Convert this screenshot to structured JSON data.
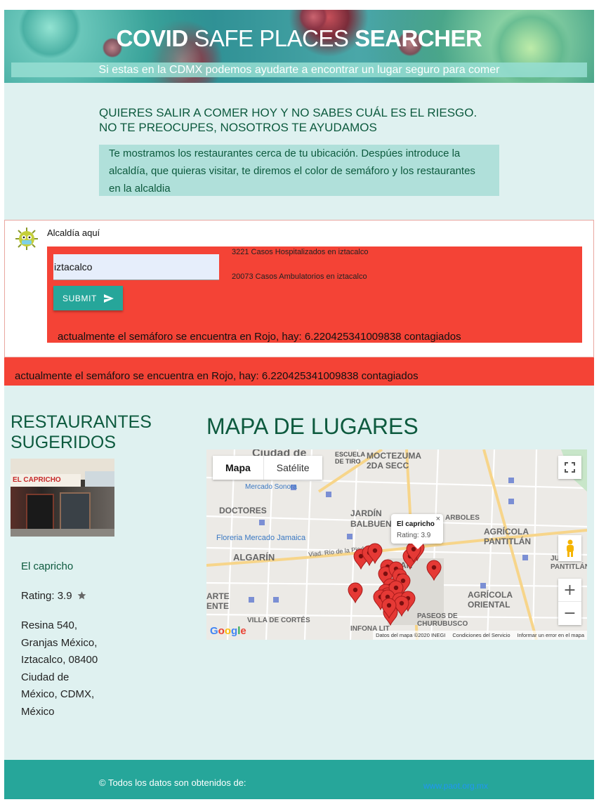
{
  "header": {
    "title_bold1": "COVID",
    "title_mid": " SAFE PLACES ",
    "title_bold2": "SEARCHER",
    "subtitle": "Si estas en la CDMX podemos ayudarte a encontrar un lugar seguro para comer"
  },
  "intro": {
    "question_line1": "QUIERES SALIR A COMER HOY Y NO SABES CUÁL ES EL RIESGO.",
    "question_line2": "NO TE PREOCUPES, NOSOTROS TE AYUDAMOS",
    "description": "Te mostramos los restaurantes cerca de tu ubicación. Despúes introduce la alcaldía, que quieras visitar, te diremos el color de semáforo y los restaurantes en la alcaldia"
  },
  "form": {
    "alcaldia_label": "Alcaldía aquí",
    "alcaldia_value": "iztacalco",
    "hospitalized": "3221 Casos Hospitalizados en iztacalco",
    "ambulatory": "20073 Casos Ambulatorios en iztacalco",
    "submit_label": "SUBMIT",
    "semaforo_text": "actualmente el semáforo se encuentra en Rojo, hay: 6.220425341009838 contagiados"
  },
  "banner": {
    "semaforo_text": "actualmente el semáforo se encuentra en Rojo, hay: 6.220425341009838 contagiados"
  },
  "restaurants": {
    "title_line1": "RESTAURANTES",
    "title_line2": "SUGERIDOS",
    "image_sign": "EL CAPRICHO",
    "name": "El capricho",
    "rating": "Rating: 3.9",
    "rating_icon": "star-icon",
    "address": "Resina 540, Granjas México, Iztacalco, 08400 Ciudad de México, CDMX, México"
  },
  "map": {
    "title": "MAPA DE LUGARES",
    "type_map": "Mapa",
    "type_satellite": "Satélite",
    "popup_name": "El capricho",
    "popup_rating": "Rating: 3.9",
    "popup_close": "×",
    "zoom_in": "+",
    "zoom_out": "−",
    "fullscreen_icon": "fullscreen-icon",
    "pegman_icon": "pegman-icon",
    "google_logo": "Google",
    "attribution_data": "Datos del mapa ©2020 INEGI",
    "attribution_terms": "Condiciones del Servicio",
    "attribution_report": "Informar un error en el mapa",
    "labels": {
      "l1": "Ciudad de",
      "l2": "ESCUELA DE TIRO",
      "l3": "MOCTEZUMA 2DA SECC",
      "l4": "Mercado Sonora",
      "l5": "DOCTORES",
      "l6": "JARDÍN BALBUENA",
      "l7": "ARBOLES",
      "l8": "Floreria Mercado Jamaica",
      "l9": "AGRÍCOLA PANTITLÁN",
      "l10": "ALGARÍN",
      "l11": "Viad. Río de la Piedad",
      "l12": "GRAN MÉX",
      "l13": "JUÁREZ PANTITLÁN",
      "l14": "ARTE ENTE",
      "l15": "AGRÍCOLA ORIENTAL",
      "l16": "VILLA DE CORTÉS",
      "l17": "PASEOS DE CHURUBUSCO",
      "l18": "INFONA LIT"
    }
  },
  "footer": {
    "copyright": "© Todos los datos son obtenidos de:",
    "link": "www.paot.org.mx"
  },
  "colors": {
    "teal": "#26a69a",
    "red": "#f44336",
    "dark_green": "#0d5a3e",
    "light_bg": "#dff1f0"
  }
}
